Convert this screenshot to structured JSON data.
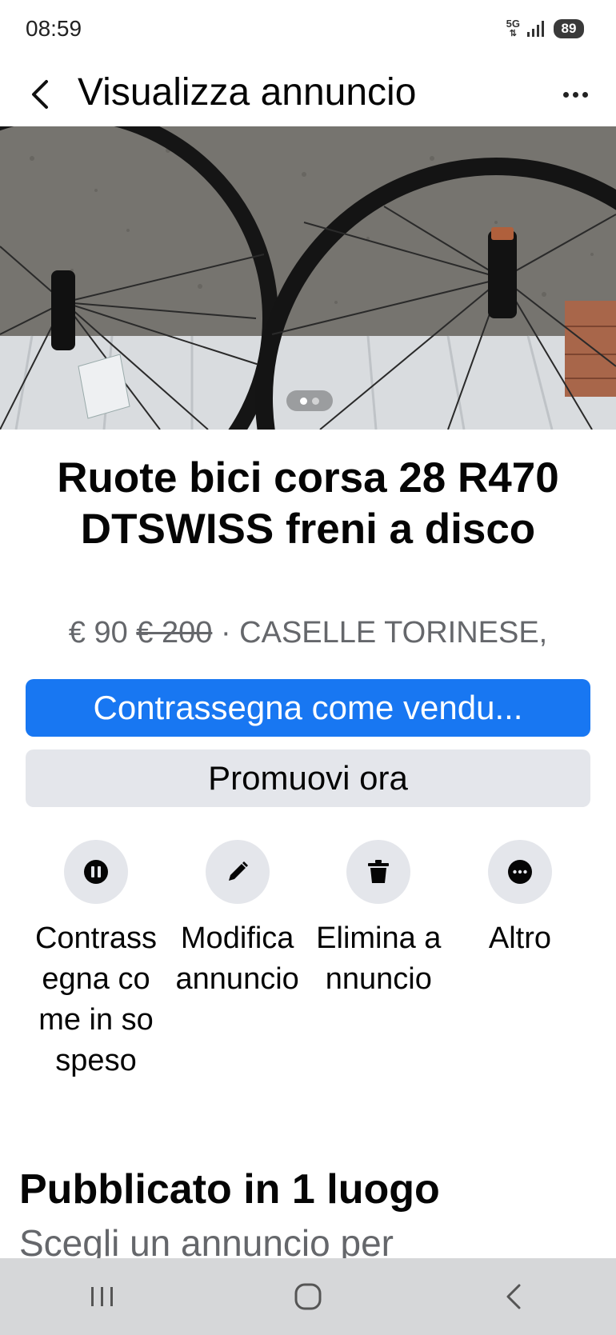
{
  "status_bar": {
    "time": "08:59",
    "network_label": "5G",
    "battery": "89",
    "icons": [
      "signal-icon",
      "battery-icon"
    ]
  },
  "header": {
    "title": "Visualizza annuncio",
    "back_icon": "chevron-left-icon",
    "more_icon": "more-horizontal-icon"
  },
  "listing": {
    "title": "Ruote bici corsa 28 R470 DTSWISS freni a disco",
    "price": "€ 90",
    "original_price": "€ 200",
    "separator": "·",
    "location": "CASELLE TORINESE,",
    "image_count": 2,
    "current_image": 1
  },
  "buttons": {
    "mark_sold": "Contrassegna come vendu...",
    "promote": "Promuovi ora"
  },
  "actions": [
    {
      "label": "Contrassegna come in sospeso",
      "icon": "pause-icon"
    },
    {
      "label": "Modifica annuncio",
      "icon": "pencil-icon"
    },
    {
      "label": "Elimina annuncio",
      "icon": "trash-icon"
    },
    {
      "label": "Altro",
      "icon": "more-horizontal-icon"
    }
  ],
  "published": {
    "title": "Pubblicato in 1 luogo",
    "subtitle": "Scegli un annuncio per"
  },
  "colors": {
    "primary": "#1877f2",
    "secondary_bg": "#e4e6eb",
    "muted_text": "#65676b"
  }
}
